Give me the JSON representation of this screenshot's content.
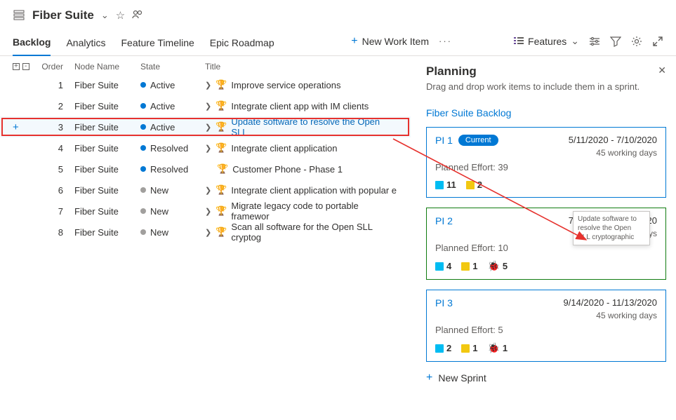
{
  "header": {
    "title": "Fiber Suite"
  },
  "tabs": {
    "backlog": "Backlog",
    "analytics": "Analytics",
    "timeline": "Feature Timeline",
    "roadmap": "Epic Roadmap"
  },
  "toolbar": {
    "new_item": "New Work Item",
    "features": "Features"
  },
  "columns": {
    "order": "Order",
    "node": "Node Name",
    "state": "State",
    "title": "Title"
  },
  "states": {
    "active": "Active",
    "resolved": "Resolved",
    "new": "New"
  },
  "rows": [
    {
      "order": "1",
      "node": "Fiber Suite",
      "state": "active",
      "title": "Improve service operations"
    },
    {
      "order": "2",
      "node": "Fiber Suite",
      "state": "active",
      "title": "Integrate client app with IM clients"
    },
    {
      "order": "3",
      "node": "Fiber Suite",
      "state": "active",
      "title": "Update software to resolve the Open SLL",
      "highlight": true
    },
    {
      "order": "4",
      "node": "Fiber Suite",
      "state": "resolved",
      "title": "Integrate client application"
    },
    {
      "order": "5",
      "node": "Fiber Suite",
      "state": "resolved",
      "title": "Customer Phone - Phase 1"
    },
    {
      "order": "6",
      "node": "Fiber Suite",
      "state": "new",
      "title": "Integrate client application with popular e"
    },
    {
      "order": "7",
      "node": "Fiber Suite",
      "state": "new",
      "title": "Migrate legacy code to portable framewor"
    },
    {
      "order": "8",
      "node": "Fiber Suite",
      "state": "new",
      "title": "Scan all software for the Open SLL cryptog"
    }
  ],
  "panel": {
    "title": "Planning",
    "subtitle": "Drag and drop work items to include them in a sprint.",
    "backlog_label": "Fiber Suite Backlog",
    "sprints": [
      {
        "name": "PI 1",
        "current": "Current",
        "dates": "5/11/2020 - 7/10/2020",
        "days": "45 working days",
        "effort": "Planned Effort: 39",
        "feat": "11",
        "story": "2"
      },
      {
        "name": "PI 2",
        "dates": "7/13/2020 - 9/11/2020",
        "days": "45 working days",
        "effort": "Planned Effort: 10",
        "feat": "4",
        "story": "1",
        "bug": "5",
        "drop": true
      },
      {
        "name": "PI 3",
        "dates": "9/14/2020 - 11/13/2020",
        "days": "45 working days",
        "effort": "Planned Effort: 5",
        "feat": "2",
        "story": "1",
        "bug": "1"
      }
    ],
    "ghost": "Update software to resolve the Open SLL cryptographic",
    "new_sprint": "New Sprint"
  }
}
